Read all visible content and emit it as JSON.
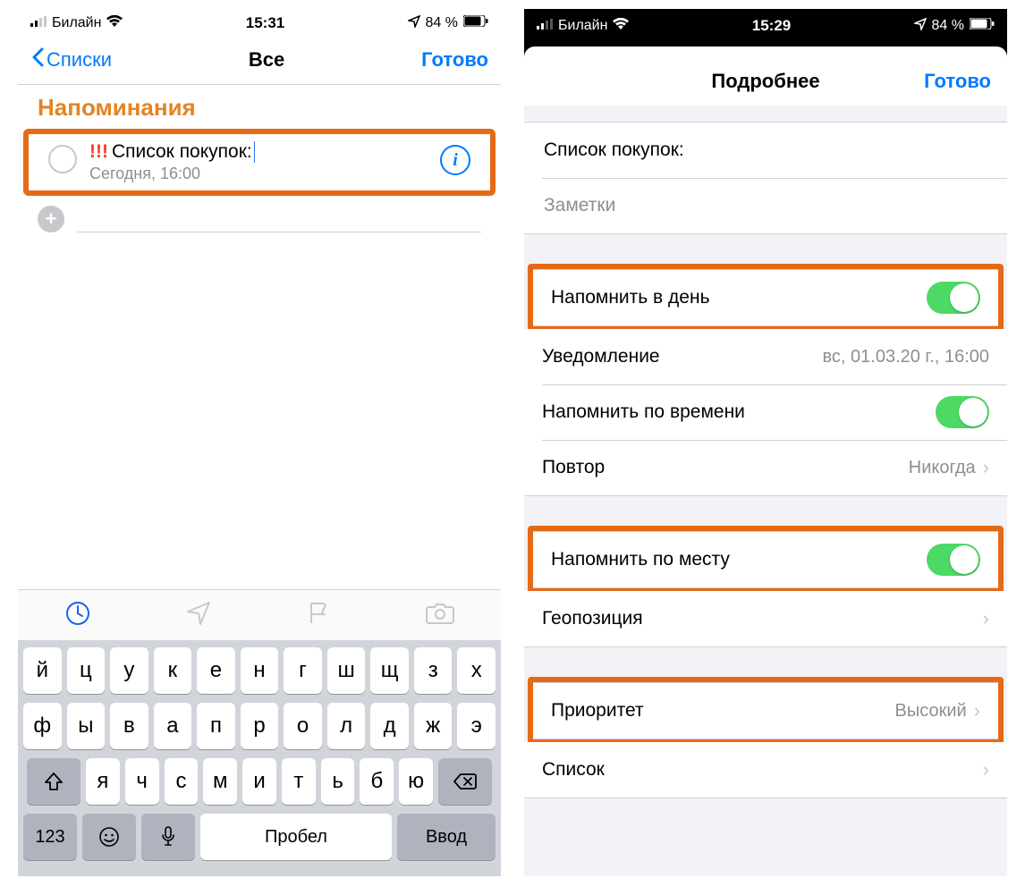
{
  "left": {
    "status": {
      "carrier": "Билайн",
      "time": "15:31",
      "battery_text": "84 %"
    },
    "nav": {
      "back": "Списки",
      "title": "Все",
      "done": "Готово"
    },
    "section_title": "Напоминания",
    "reminder": {
      "priority_marks": "!!!",
      "title": "Список покупок:",
      "subtitle": "Сегодня, 16:00"
    },
    "keyboard": {
      "row1": [
        "й",
        "ц",
        "у",
        "к",
        "е",
        "н",
        "г",
        "ш",
        "щ",
        "з",
        "х"
      ],
      "row2": [
        "ф",
        "ы",
        "в",
        "а",
        "п",
        "р",
        "о",
        "л",
        "д",
        "ж",
        "э"
      ],
      "row3": [
        "я",
        "ч",
        "с",
        "м",
        "и",
        "т",
        "ь",
        "б",
        "ю"
      ],
      "num_key": "123",
      "space_key": "Пробел",
      "enter_key": "Ввод"
    }
  },
  "right": {
    "status": {
      "carrier": "Билайн",
      "time": "15:29",
      "battery_text": "84 %"
    },
    "nav": {
      "title": "Подробнее",
      "done": "Готово"
    },
    "title_field": "Список покупок:",
    "notes_placeholder": "Заметки",
    "rows": {
      "remind_day": "Напомнить в день",
      "alert_label": "Уведомление",
      "alert_value": "вс, 01.03.20 г., 16:00",
      "remind_time": "Напомнить по времени",
      "repeat_label": "Повтор",
      "repeat_value": "Никогда",
      "remind_location": "Напомнить по месту",
      "location_label": "Геопозиция",
      "priority_label": "Приоритет",
      "priority_value": "Высокий",
      "list_label": "Список"
    }
  }
}
